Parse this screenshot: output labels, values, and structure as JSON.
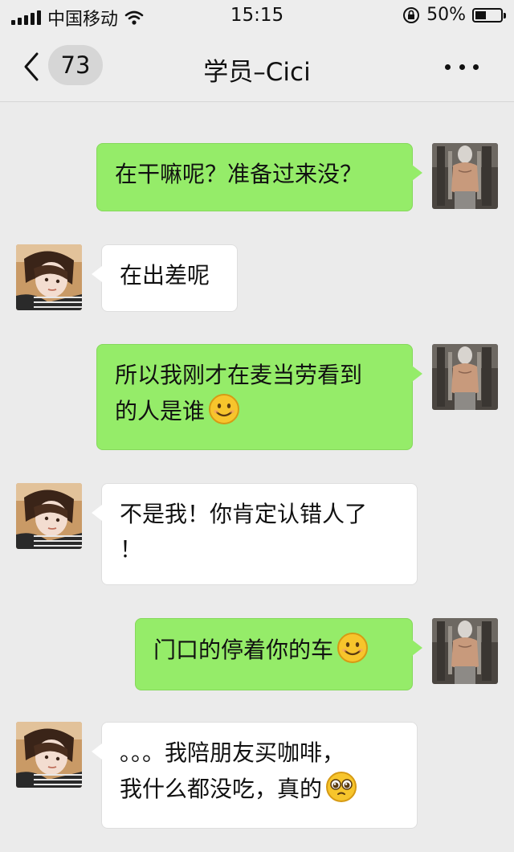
{
  "status_bar": {
    "carrier": "中国移动",
    "time": "15:15",
    "battery_label": "50%",
    "battery_level": 0.5
  },
  "nav": {
    "unread_count": "73",
    "title": "学员–Cici"
  },
  "messages": [
    {
      "direction": "out",
      "text": "在干嘛呢？准备过来没？"
    },
    {
      "direction": "in",
      "text": "在出差呢"
    },
    {
      "direction": "out",
      "line1": "所以我刚才在麦当劳看到",
      "line2": "的人是谁",
      "emoji": "smile"
    },
    {
      "direction": "in",
      "line1": "不是我！你肯定认错人了",
      "line2": "！"
    },
    {
      "direction": "out",
      "text": "门口的停着你的车",
      "emoji": "smile"
    },
    {
      "direction": "in",
      "line1": "。。。我陪朋友买咖啡，",
      "line2": "我什么都没吃，真的",
      "emoji": "pleading"
    }
  ],
  "colors": {
    "background": "#ebebeb",
    "outgoing_bubble": "#95ec69",
    "incoming_bubble": "#ffffff"
  }
}
